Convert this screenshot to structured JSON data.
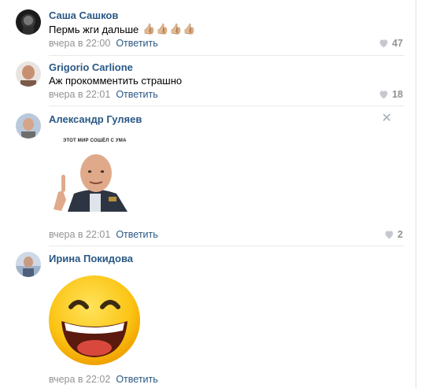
{
  "comments": [
    {
      "author": "Саша Сашков",
      "text": "Пермь жги дальше",
      "emoji": "👍🏼",
      "emoji_count": 4,
      "time": "вчера в 22:00",
      "reply": "Ответить",
      "likes": "47"
    },
    {
      "author": "Grigorio Carlione",
      "text": "Аж прокомментить страшно",
      "time": "вчера в 22:01",
      "reply": "Ответить",
      "likes": "18"
    },
    {
      "author": "Александр Гуляев",
      "sticker_caption": "ЭТОТ МИР СОШЁЛ С УМА",
      "time": "вчера в 22:01",
      "reply": "Ответить",
      "likes": "2"
    },
    {
      "author": "Ирина Покидова",
      "time": "вчера в 22:02",
      "reply": "Ответить"
    }
  ],
  "colors": {
    "link": "#2a5885",
    "meta": "#939393",
    "divider": "#e7e8ec"
  }
}
